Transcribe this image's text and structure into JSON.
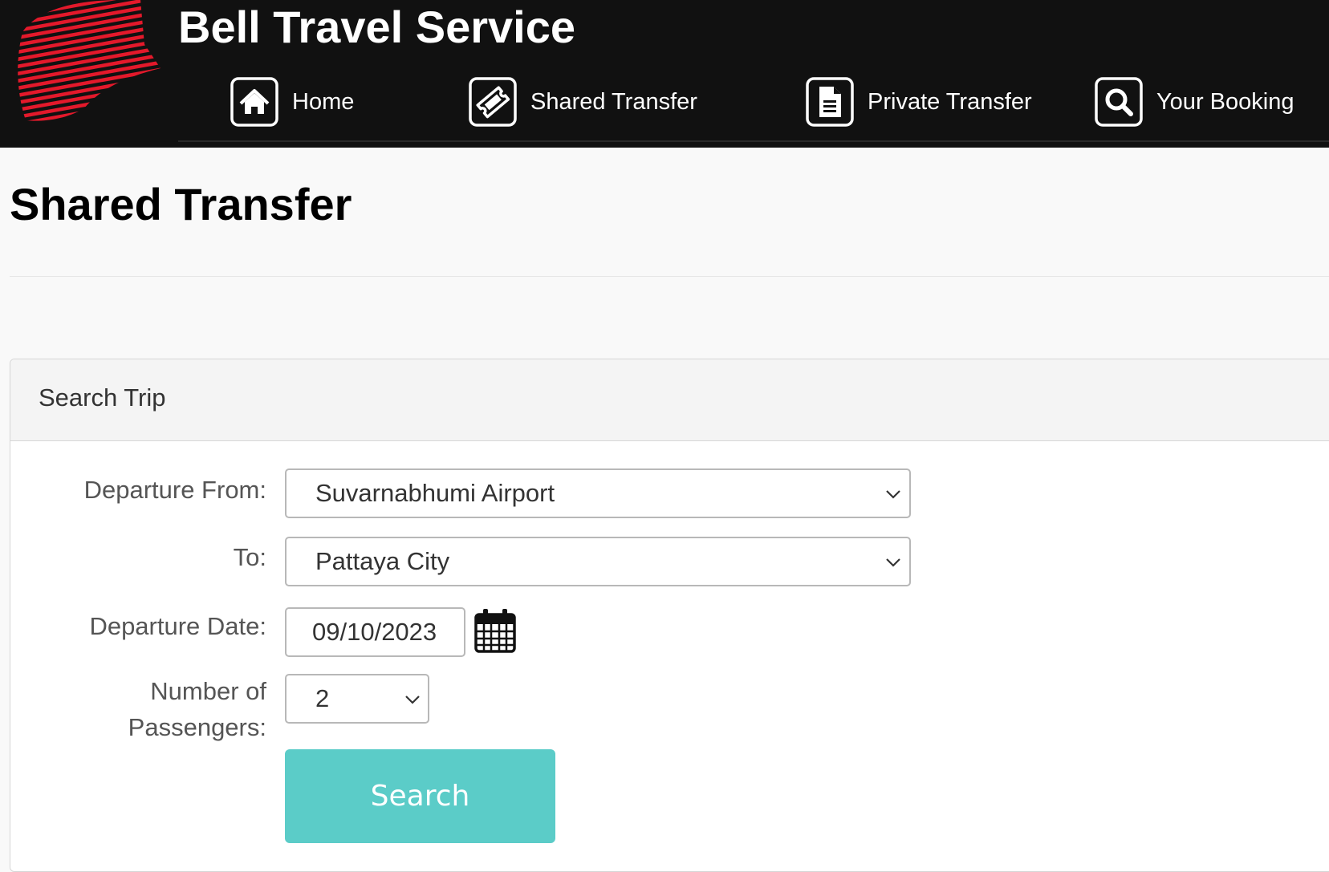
{
  "header": {
    "site_title": "Bell Travel Service",
    "brand_color": "#e3192b",
    "background_color": "#111111",
    "nav": [
      {
        "label": "Home",
        "icon": "home-icon"
      },
      {
        "label": "Shared Transfer",
        "icon": "ticket-icon"
      },
      {
        "label": "Private Transfer",
        "icon": "document-icon"
      },
      {
        "label": "Your Booking",
        "icon": "search-icon"
      }
    ]
  },
  "main": {
    "page_title": "Shared Transfer",
    "card": {
      "title": "Search Trip",
      "form": {
        "departure_from_label": "Departure From:",
        "departure_from_value": "Suvarnabhumi Airport",
        "to_label": "To:",
        "to_value": "Pattaya City",
        "date_label": "Departure Date:",
        "date_value": "09/10/2023",
        "passengers_label_line1": "Number of",
        "passengers_label_line2": "Passengers:",
        "passengers_value": "2",
        "search_label": "Search",
        "search_button_color": "#5bccc8"
      }
    }
  }
}
